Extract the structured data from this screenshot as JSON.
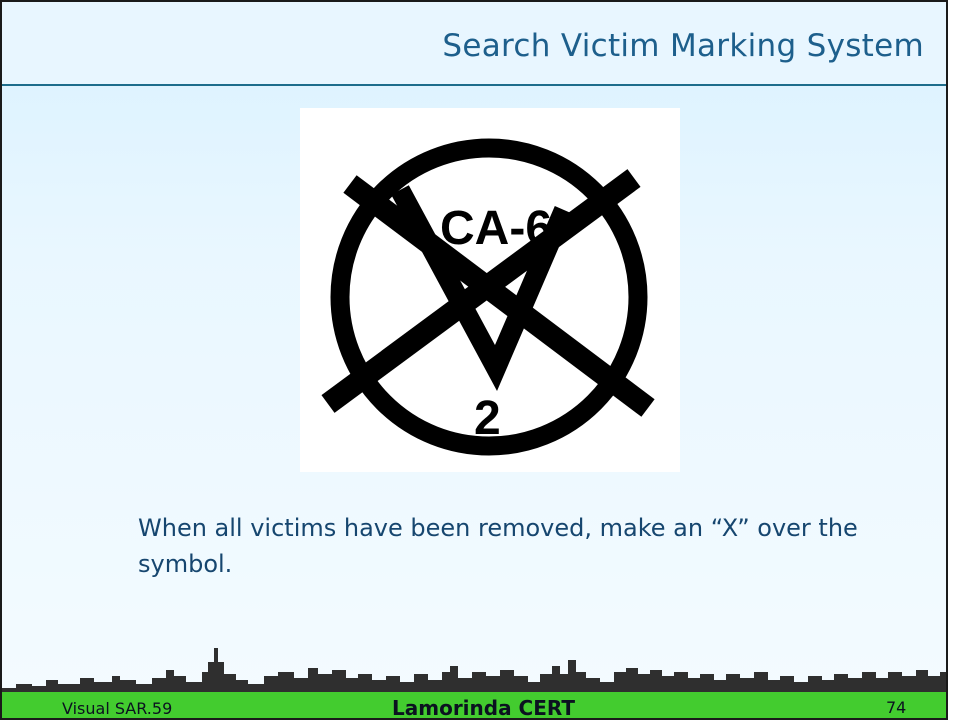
{
  "slide": {
    "title": "Search Victim Marking System",
    "symbol": {
      "name": "victim-marking-symbol",
      "top_label": "CA-6",
      "bottom_label": "2",
      "colors": {
        "stroke": "#000000",
        "background": "#ffffff"
      }
    },
    "caption": "When all victims have been removed, make an “X” over the symbol."
  },
  "footer": {
    "left_text": "Visual SAR.59",
    "center_text": "Lamorinda CERT",
    "page_number": "74",
    "colors": {
      "bar": "#43cc2f",
      "skyline": "#2f2f2f"
    }
  },
  "colors": {
    "title": "#1d5f8c",
    "caption": "#16466f",
    "background": "#e4f5ff"
  }
}
